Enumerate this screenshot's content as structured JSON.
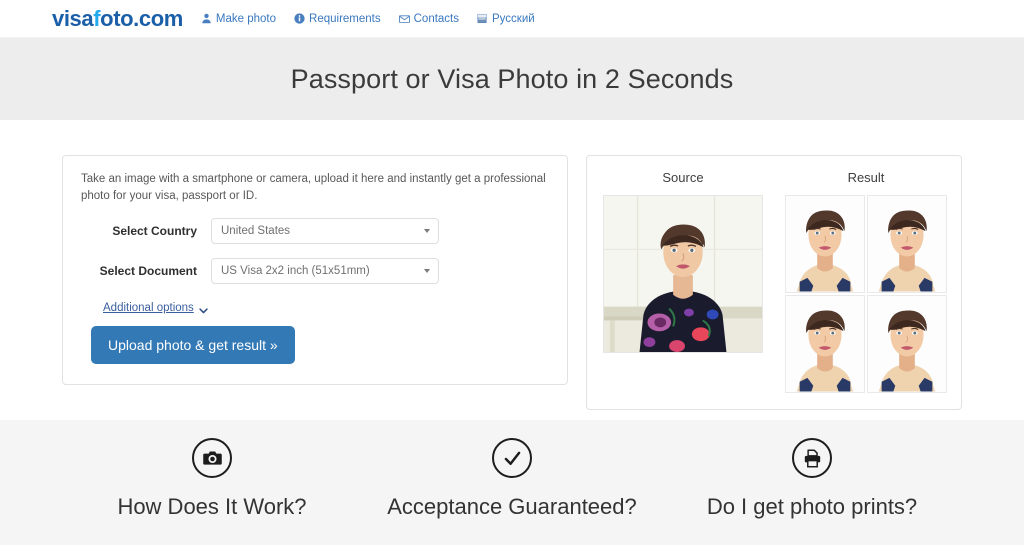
{
  "header": {
    "logo": {
      "prefix": "visa",
      "highlight": "f",
      "suffix": "oto.com"
    },
    "nav": [
      {
        "label": "Make photo",
        "icon": "person-icon"
      },
      {
        "label": "Requirements",
        "icon": "info-icon"
      },
      {
        "label": "Contacts",
        "icon": "envelope-icon"
      },
      {
        "label": "Русский",
        "icon": "flag-icon"
      }
    ]
  },
  "hero": {
    "title": "Passport or Visa Photo in 2 Seconds"
  },
  "form": {
    "intro": "Take an image with a smartphone or camera, upload it here and instantly get a professional photo for your visa, passport or ID.",
    "country_label": "Select Country",
    "country_value": "United States",
    "document_label": "Select Document",
    "document_value": "US Visa 2x2 inch (51x51mm)",
    "additional_options": "Additional options",
    "upload_button": "Upload photo & get result »"
  },
  "preview": {
    "source_title": "Source",
    "result_title": "Result",
    "source_alt": "woman-portrait-source-photo",
    "result_alt": "passport-photo-result",
    "result_count": 4
  },
  "features": [
    {
      "title": "How Does It Work?",
      "icon": "camera-icon"
    },
    {
      "title": "Acceptance Guaranteed?",
      "icon": "check-circle-icon"
    },
    {
      "title": "Do I get photo prints?",
      "icon": "printer-icon"
    }
  ],
  "colors": {
    "logo_dark": "#1b5fa8",
    "logo_light": "#23a9ee",
    "nav_link": "#3a78bf",
    "hero_bg": "#ededed",
    "button_blue": "#3379b5",
    "features_bg": "#f5f5f6"
  }
}
